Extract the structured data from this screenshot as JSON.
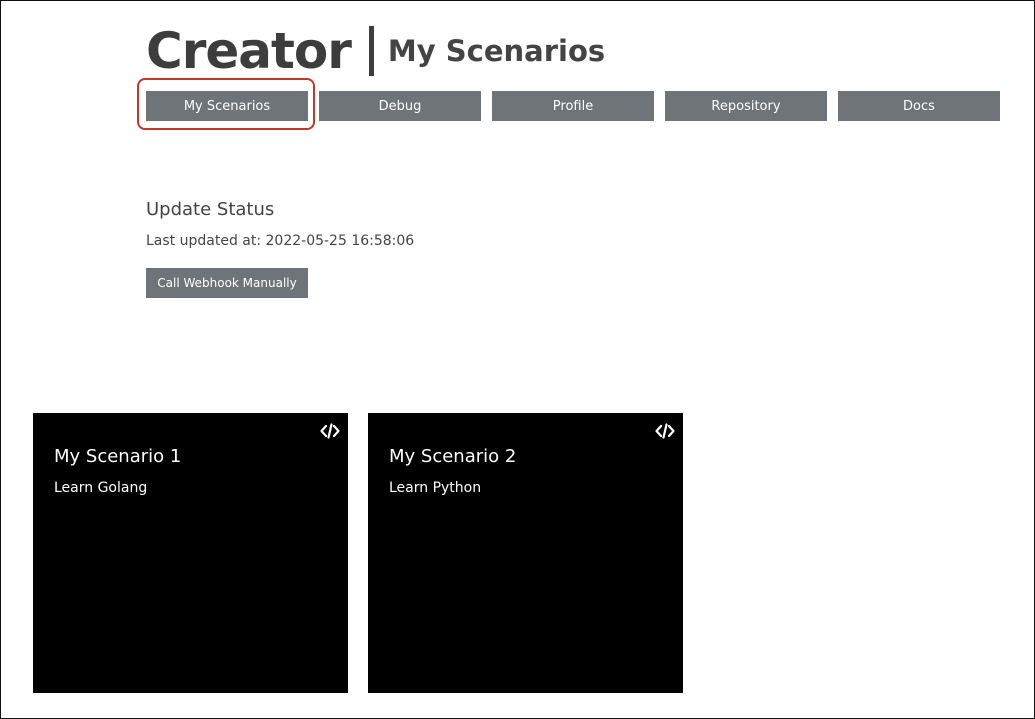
{
  "header": {
    "brand": "Creator",
    "page_title": "My Scenarios"
  },
  "nav": {
    "tabs": [
      {
        "label": "My Scenarios",
        "active": true
      },
      {
        "label": "Debug"
      },
      {
        "label": "Profile"
      },
      {
        "label": "Repository"
      },
      {
        "label": "Docs"
      }
    ]
  },
  "status": {
    "heading": "Update Status",
    "last_updated": "Last updated at: 2022-05-25 16:58:06",
    "webhook_button": "Call Webhook Manually"
  },
  "scenarios": [
    {
      "title": "My Scenario 1",
      "description": "Learn Golang",
      "icon": "code-icon"
    },
    {
      "title": "My Scenario 2",
      "description": "Learn Python",
      "icon": "code-icon"
    }
  ],
  "colors": {
    "button_bg": "#6f7478",
    "highlight": "#c0392b",
    "card_bg": "#000000"
  }
}
